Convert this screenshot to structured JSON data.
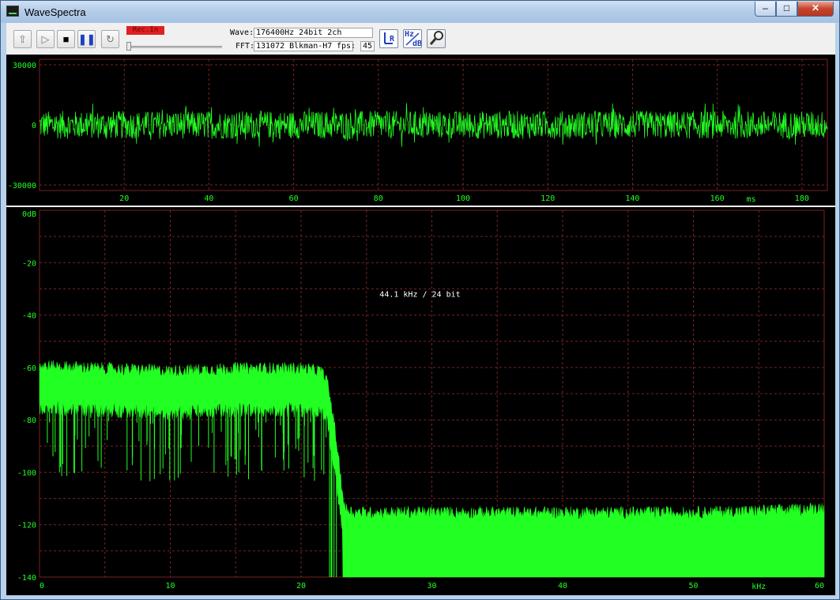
{
  "window": {
    "title": "WaveSpectra",
    "controls": {
      "minimize": "–",
      "maximize": "□",
      "close": "✕"
    }
  },
  "toolbar": {
    "buttons": [
      {
        "name": "open",
        "icon": "open-file-icon"
      },
      {
        "name": "play",
        "icon": "play-icon"
      },
      {
        "name": "stop",
        "icon": "stop-icon"
      },
      {
        "name": "pause",
        "icon": "pause-icon"
      },
      {
        "name": "loop",
        "icon": "loop-icon"
      }
    ],
    "rec_label": "Rec.In",
    "rec_color": "#e02020",
    "wave_label": "Wave:",
    "wave_value": "176400Hz 24bit 2ch",
    "fft_label": "FFT:",
    "fft_value": "131072 Blkman-H7",
    "fps_label": "fps:",
    "fps_value": "45",
    "icons": {
      "lr": "L R",
      "hzdb": "Hz dB",
      "settings": "wrench-icon"
    }
  },
  "waveform": {
    "y_ticks": [
      "30000",
      "0",
      "-30000"
    ],
    "x_ticks": [
      "20",
      "40",
      "60",
      "80",
      "100",
      "120",
      "140",
      "160",
      "180"
    ],
    "x_unit": "ms",
    "trace_color": "#22ff22",
    "grid_color": "#7a2222"
  },
  "spectrum": {
    "y_ticks": [
      "0dB",
      "-20",
      "-40",
      "-60",
      "-80",
      "-100",
      "-120",
      "-140"
    ],
    "x_ticks": [
      "0",
      "10",
      "20",
      "30",
      "40",
      "50",
      "60"
    ],
    "x_unit": "kHz",
    "annotation": "44.1 kHz / 24 bit",
    "trace_color": "#22ff22"
  },
  "chart_data": [
    {
      "type": "line",
      "x_unit": "ms",
      "xlim": [
        0,
        186
      ],
      "ylim": [
        -32768,
        32767
      ],
      "y_ticks": [
        30000,
        0,
        -30000
      ],
      "x_ticks": [
        20,
        40,
        60,
        80,
        100,
        120,
        140,
        160,
        180
      ],
      "series": [
        {
          "values_description_free": true,
          "center": 0,
          "typical_peak": 7000,
          "max_peak": 11000
        }
      ]
    },
    {
      "type": "line",
      "xlabel": "kHz",
      "ylabel": "dB",
      "xlim": [
        0,
        60
      ],
      "ylim": [
        -140,
        0
      ],
      "x_ticks": [
        0,
        10,
        20,
        30,
        40,
        50,
        60
      ],
      "y_ticks": [
        0,
        -20,
        -40,
        -60,
        -80,
        -100,
        -120,
        -140
      ],
      "annotation": "44.1 kHz / 24 bit",
      "series": [
        {
          "x": [
            0,
            5,
            10,
            15,
            20,
            21.5,
            22,
            22.5,
            23,
            23.3,
            24,
            30,
            40,
            50,
            58,
            60
          ],
          "values": [
            -64,
            -65,
            -66,
            -65,
            -65,
            -66,
            -70,
            -85,
            -105,
            -118,
            -120,
            -120,
            -120,
            -120,
            -119,
            -118
          ]
        }
      ]
    }
  ]
}
